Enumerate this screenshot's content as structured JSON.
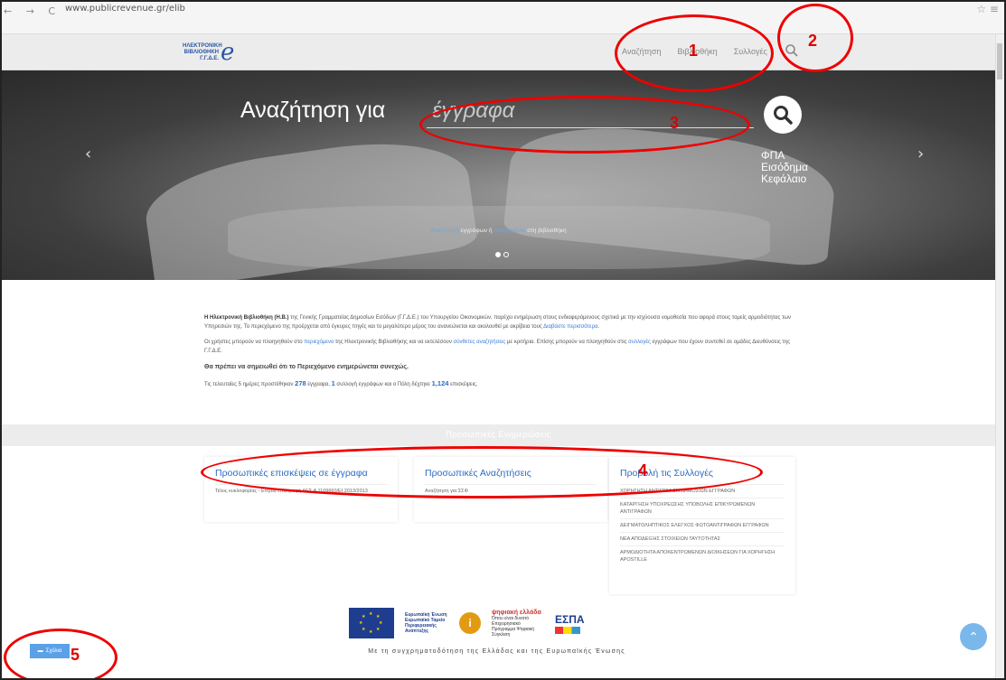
{
  "browser": {
    "nav_glyphs": "← → C",
    "url": "www.publicrevenue.gr/elib",
    "bookmark_glyph": "☆ ≡"
  },
  "header": {
    "logo_lines": [
      "ΗΛΕΚΤΡΟΝΙΚΗ",
      "ΒΙΒΛΙΟΘΗΚΗ",
      "Γ.Γ.Δ.Ε."
    ],
    "logo_mark": "e",
    "nav": [
      "Αναζήτηση",
      "Βιβλιοθήκη",
      "Συλλογές"
    ]
  },
  "hero": {
    "title": "Αναζήτηση για",
    "placeholder": "έγγραφα",
    "suggestions": [
      "ΦΠΑ",
      "Εισόδημα",
      "Κεφάλαιο"
    ],
    "prev": "‹",
    "next": "›",
    "caption_link1": "Αναζήτηση",
    "caption_mid": " εγγράφων ή ",
    "caption_link2": "πλοηγηθείτε",
    "caption_end": " στη βιβλιοθήκη"
  },
  "intro": {
    "p1_bold": "Η Ηλεκτρονική Βιβλιοθήκη (Η.Β.)",
    "p1": " της Γενικής Γραμματείας Δημοσίων Εσόδων (Γ.Γ.Δ.Ε.) του Υπουργείου Οικονομικών, παρέχει ενημέρωση στους ενδιαφερόμενους σχετικά με την ισχύουσα νομοθεσία που αφορά στους τομείς αρμοδιότητας των Υπηρεσιών της. Το περιεχόμενο της προέρχεται από έγκυρες πηγές και το μεγαλύτερο μέρος του ανανεώνεται και ακολουθεί με ακρίβεια τους ",
    "p1_link": "Διαβάστε περισσότερα.",
    "p2": "Οι χρήστες μπορούν να πλοηγηθούν στο ",
    "p2_link1": "περιεχόμενο",
    "p2_mid": " της Ηλεκτρονικής Βιβλιοθήκης και να εκτελέσουν ",
    "p2_link2": "σύνθετες αναζητήσεις",
    "p2_mid2": " με κριτήρια. Επίσης μπορούν να πλοηγηθούν στις ",
    "p2_link3": "συλλογές",
    "p2_end": " εγγράφων που έχουν συντεθεί σε ομάδες Διευθύνσεις της Γ.Γ.Δ.Ε.",
    "p3": "Θα πρέπει να σημειωθεί ότι το Περιεχόμενο ενημερώνεται συνεχώς.",
    "p4_a": "Τις τελευταίες 5 ημέρες προστέθηκαν ",
    "stat_docs": "278",
    "p4_b": " έγγραφα, ",
    "stat_coll": "1",
    "p4_c": " συλλογή εγγράφων και ο Πόλη δέχτηκε ",
    "stat_visits": "1,124",
    "p4_d": " επισκέψεις."
  },
  "band": {
    "title": "Προσωπικές Ενημερώσεις"
  },
  "cards": {
    "visits": {
      "title": "Προσωπικές επισκέψεις σε έγγραφα",
      "items": [
        "Τέλος κυκλοφορίας - Ετήσια επιστροφή ΔΕΣ.Α 1109660/ΕΙ 2013/2013"
      ]
    },
    "searches": {
      "title": "Προσωπικές Αναζητήσεις",
      "items": [
        "Αναζήτηση για ΣΣΦ"
      ]
    },
    "collections": {
      "title": "Προβολή τις Συλλογές",
      "items": [
        "ΧΟΡΗΓΗΣΗ ΑΝΤΙΓΡΑΦΩΝ ΔΗΜΟΣΙΩΝ ΕΓΓΡΑΦΩΝ",
        "ΚΑΤΑΡΓΗΣΗ ΥΠΟΧΡΕΩΣΗΣ ΥΠΟΒΟΛΗΣ ΕΠΙΚΥΡΩΜΕΝΩΝ ΑΝΤΙΓΡΑΦΩΝ",
        "ΔΕΙΓΜΑΤΟΛΗΠΤΙΚΟΣ ΕΛΕΓΧΟΣ ΦΩΤΟΑΝΤΙΓΡΑΦΩΝ ΕΓΓΡΑΦΩΝ",
        "ΝΕΑ ΑΠΟΔΕΙΞΗΣ ΣΤΟΙΧΕΙΩΝ ΤΑΥΤΟΤΗΤΑΣ",
        "ΑΡΜΟΔΙΟΤΗΤΑ ΑΠΟΚΕΝΤΡΩΜΕΝΩΝ ΔΙΟΙΚΗΣΕΩΝ ΓΙΑ ΧΟΡΗΓΗΣΗ APOSTILLE"
      ]
    }
  },
  "footer": {
    "eu_text": "Ευρωπαϊκή Ένωση Ευρωπαϊκό Ταμείο Περιφερειακής Ανάπτυξης",
    "dig_name": "ψηφιακή ελλάδα",
    "dig_text": "Όπου είναι δυνατό Επιχειρησιακό Πρόγραμμα Ψηφιακή Σύγκλιση",
    "espa": "ΕΣΠΑ",
    "cofin": "Με τη συγχρηματοδότηση της Ελλάδας και της Ευρωπαϊκής Ένωσης"
  },
  "feedback": {
    "label": "Σχόλια"
  },
  "annotations": [
    "1",
    "2",
    "3",
    "4",
    "5"
  ],
  "colors": {
    "annotation": "#e00000",
    "link": "#2a6cc4",
    "logo": "#2a57a6"
  }
}
